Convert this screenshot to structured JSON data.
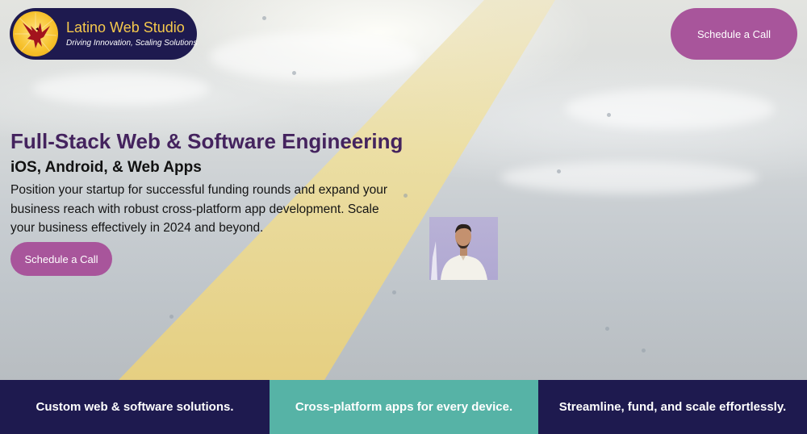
{
  "brand": {
    "name": "Latino Web Studio",
    "tagline": "Driving Innovation, Scaling Solutions"
  },
  "header": {
    "cta_label": "Schedule a Call"
  },
  "hero": {
    "headline": "Full-Stack Web & Software Engineering",
    "subheadline": "iOS, Android, & Web Apps",
    "body": "Position your startup for successful funding rounds and expand your business reach with robust cross-platform app development. Scale your business effectively in 2024 and beyond.",
    "cta_label": "Schedule a Call"
  },
  "features": [
    {
      "label": "Custom web & software solutions."
    },
    {
      "label": "Cross-platform apps for every device."
    },
    {
      "label": "Streamline, fund, and scale effortlessly."
    }
  ],
  "colors": {
    "navy": "#1e1a4f",
    "gold": "#f5c94c",
    "cta_purple": "#a8559b",
    "headline_purple": "#44235e",
    "teal": "#56b3a6"
  }
}
